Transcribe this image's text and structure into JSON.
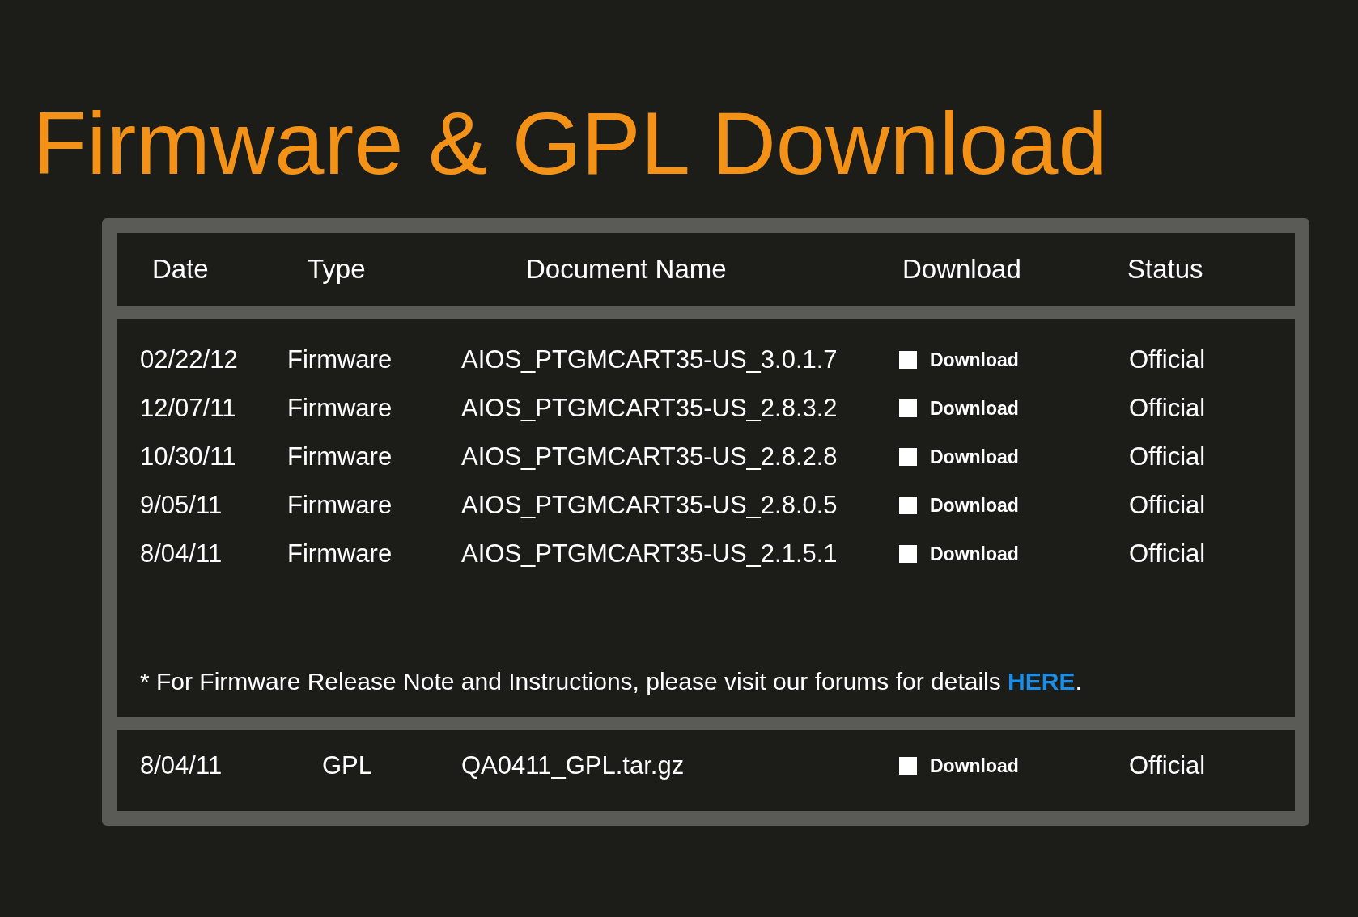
{
  "title": "Firmware & GPL Download",
  "table": {
    "columns": [
      "Date",
      "Type",
      "Document Name",
      "Download",
      "Status"
    ],
    "firmware_rows": [
      {
        "date": "02/22/12",
        "type": "Firmware",
        "document": "AIOS_PTGMCART35-US_3.0.1.7",
        "download": "Download",
        "status": "Official"
      },
      {
        "date": "12/07/11",
        "type": "Firmware",
        "document": "AIOS_PTGMCART35-US_2.8.3.2",
        "download": "Download",
        "status": "Official"
      },
      {
        "date": "10/30/11",
        "type": "Firmware",
        "document": "AIOS_PTGMCART35-US_2.8.2.8",
        "download": "Download",
        "status": "Official"
      },
      {
        "date": "9/05/11",
        "type": "Firmware",
        "document": "AIOS_PTGMCART35-US_2.8.0.5",
        "download": "Download",
        "status": "Official"
      },
      {
        "date": "8/04/11",
        "type": "Firmware",
        "document": "AIOS_PTGMCART35-US_2.1.5.1",
        "download": "Download",
        "status": "Official"
      }
    ],
    "note": {
      "text": "* For Firmware Release Note and Instructions, please visit our forums for details",
      "link": "HERE",
      "end": "."
    },
    "gpl_rows": [
      {
        "date": "8/04/11",
        "type": "GPL",
        "document": "QA0411_GPL.tar.gz",
        "download": "Download",
        "status": "Official"
      }
    ]
  }
}
